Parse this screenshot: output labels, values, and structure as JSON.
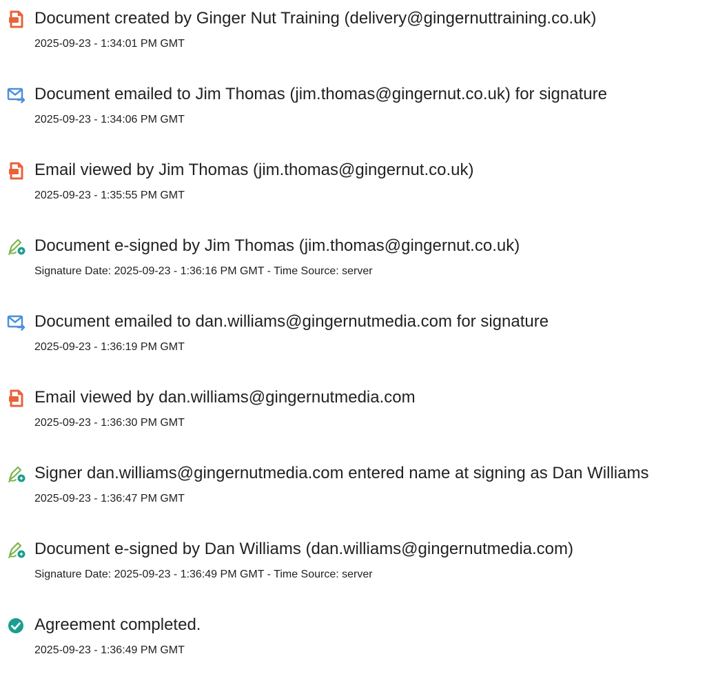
{
  "events": [
    {
      "icon": "document-created-icon",
      "title": "Document created by Ginger Nut Training (delivery@gingernuttraining.co.uk)",
      "time": "2025-09-23 - 1:34:01 PM GMT"
    },
    {
      "icon": "email-sent-icon",
      "title": "Document emailed to Jim Thomas (jim.thomas@gingernut.co.uk) for signature",
      "time": "2025-09-23 - 1:34:06 PM GMT"
    },
    {
      "icon": "document-viewed-icon",
      "title": "Email viewed by Jim Thomas (jim.thomas@gingernut.co.uk)",
      "time": "2025-09-23 - 1:35:55 PM GMT"
    },
    {
      "icon": "e-sign-icon",
      "title": "Document e-signed by Jim Thomas (jim.thomas@gingernut.co.uk)",
      "time": "Signature Date: 2025-09-23 - 1:36:16 PM GMT - Time Source: server"
    },
    {
      "icon": "email-sent-icon",
      "title": "Document emailed to dan.williams@gingernutmedia.com for signature",
      "time": "2025-09-23 - 1:36:19 PM GMT"
    },
    {
      "icon": "document-viewed-icon",
      "title": "Email viewed by dan.williams@gingernutmedia.com",
      "time": "2025-09-23 - 1:36:30 PM GMT"
    },
    {
      "icon": "e-sign-icon",
      "title": "Signer dan.williams@gingernutmedia.com entered name at signing as Dan Williams",
      "time": "2025-09-23 - 1:36:47 PM GMT"
    },
    {
      "icon": "e-sign-icon",
      "title": "Document e-signed by Dan Williams (dan.williams@gingernutmedia.com)",
      "time": "Signature Date: 2025-09-23 - 1:36:49 PM GMT - Time Source: server"
    },
    {
      "icon": "checkmark-circle-icon",
      "title": "Agreement completed.",
      "time": "2025-09-23 - 1:36:49 PM GMT"
    }
  ],
  "colors": {
    "document_icon": "#e8623a",
    "email_icon": "#4a90d9",
    "sign_icon": "#7ab648",
    "sign_badge": "#1a9e8f",
    "complete_icon": "#1a9e8f"
  }
}
